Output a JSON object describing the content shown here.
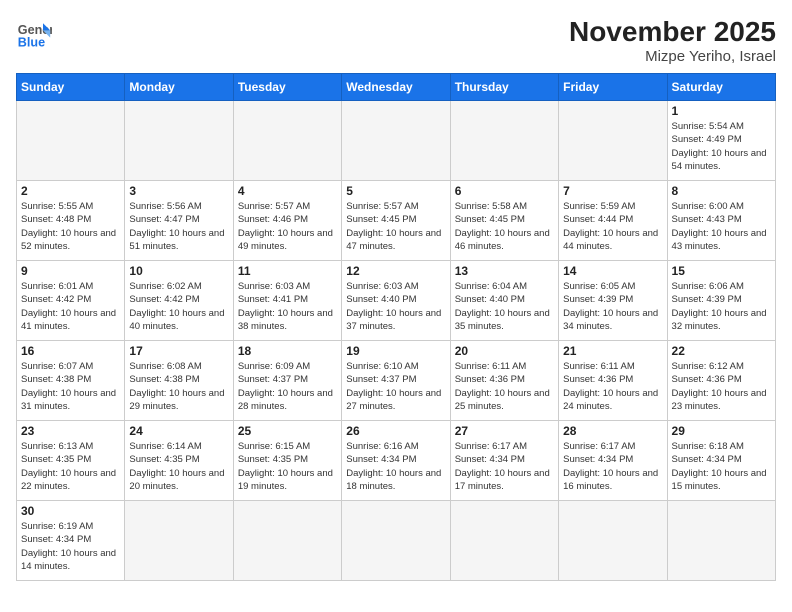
{
  "logo": {
    "line1": "General",
    "line2": "Blue"
  },
  "header": {
    "month": "November 2025",
    "location": "Mizpe Yeriho, Israel"
  },
  "days_of_week": [
    "Sunday",
    "Monday",
    "Tuesday",
    "Wednesday",
    "Thursday",
    "Friday",
    "Saturday"
  ],
  "weeks": [
    [
      {
        "day": "",
        "info": ""
      },
      {
        "day": "",
        "info": ""
      },
      {
        "day": "",
        "info": ""
      },
      {
        "day": "",
        "info": ""
      },
      {
        "day": "",
        "info": ""
      },
      {
        "day": "",
        "info": ""
      },
      {
        "day": "1",
        "info": "Sunrise: 5:54 AM\nSunset: 4:49 PM\nDaylight: 10 hours\nand 54 minutes."
      }
    ],
    [
      {
        "day": "2",
        "info": "Sunrise: 5:55 AM\nSunset: 4:48 PM\nDaylight: 10 hours\nand 52 minutes."
      },
      {
        "day": "3",
        "info": "Sunrise: 5:56 AM\nSunset: 4:47 PM\nDaylight: 10 hours\nand 51 minutes."
      },
      {
        "day": "4",
        "info": "Sunrise: 5:57 AM\nSunset: 4:46 PM\nDaylight: 10 hours\nand 49 minutes."
      },
      {
        "day": "5",
        "info": "Sunrise: 5:57 AM\nSunset: 4:45 PM\nDaylight: 10 hours\nand 47 minutes."
      },
      {
        "day": "6",
        "info": "Sunrise: 5:58 AM\nSunset: 4:45 PM\nDaylight: 10 hours\nand 46 minutes."
      },
      {
        "day": "7",
        "info": "Sunrise: 5:59 AM\nSunset: 4:44 PM\nDaylight: 10 hours\nand 44 minutes."
      },
      {
        "day": "8",
        "info": "Sunrise: 6:00 AM\nSunset: 4:43 PM\nDaylight: 10 hours\nand 43 minutes."
      }
    ],
    [
      {
        "day": "9",
        "info": "Sunrise: 6:01 AM\nSunset: 4:42 PM\nDaylight: 10 hours\nand 41 minutes."
      },
      {
        "day": "10",
        "info": "Sunrise: 6:02 AM\nSunset: 4:42 PM\nDaylight: 10 hours\nand 40 minutes."
      },
      {
        "day": "11",
        "info": "Sunrise: 6:03 AM\nSunset: 4:41 PM\nDaylight: 10 hours\nand 38 minutes."
      },
      {
        "day": "12",
        "info": "Sunrise: 6:03 AM\nSunset: 4:40 PM\nDaylight: 10 hours\nand 37 minutes."
      },
      {
        "day": "13",
        "info": "Sunrise: 6:04 AM\nSunset: 4:40 PM\nDaylight: 10 hours\nand 35 minutes."
      },
      {
        "day": "14",
        "info": "Sunrise: 6:05 AM\nSunset: 4:39 PM\nDaylight: 10 hours\nand 34 minutes."
      },
      {
        "day": "15",
        "info": "Sunrise: 6:06 AM\nSunset: 4:39 PM\nDaylight: 10 hours\nand 32 minutes."
      }
    ],
    [
      {
        "day": "16",
        "info": "Sunrise: 6:07 AM\nSunset: 4:38 PM\nDaylight: 10 hours\nand 31 minutes."
      },
      {
        "day": "17",
        "info": "Sunrise: 6:08 AM\nSunset: 4:38 PM\nDaylight: 10 hours\nand 29 minutes."
      },
      {
        "day": "18",
        "info": "Sunrise: 6:09 AM\nSunset: 4:37 PM\nDaylight: 10 hours\nand 28 minutes."
      },
      {
        "day": "19",
        "info": "Sunrise: 6:10 AM\nSunset: 4:37 PM\nDaylight: 10 hours\nand 27 minutes."
      },
      {
        "day": "20",
        "info": "Sunrise: 6:11 AM\nSunset: 4:36 PM\nDaylight: 10 hours\nand 25 minutes."
      },
      {
        "day": "21",
        "info": "Sunrise: 6:11 AM\nSunset: 4:36 PM\nDaylight: 10 hours\nand 24 minutes."
      },
      {
        "day": "22",
        "info": "Sunrise: 6:12 AM\nSunset: 4:36 PM\nDaylight: 10 hours\nand 23 minutes."
      }
    ],
    [
      {
        "day": "23",
        "info": "Sunrise: 6:13 AM\nSunset: 4:35 PM\nDaylight: 10 hours\nand 22 minutes."
      },
      {
        "day": "24",
        "info": "Sunrise: 6:14 AM\nSunset: 4:35 PM\nDaylight: 10 hours\nand 20 minutes."
      },
      {
        "day": "25",
        "info": "Sunrise: 6:15 AM\nSunset: 4:35 PM\nDaylight: 10 hours\nand 19 minutes."
      },
      {
        "day": "26",
        "info": "Sunrise: 6:16 AM\nSunset: 4:34 PM\nDaylight: 10 hours\nand 18 minutes."
      },
      {
        "day": "27",
        "info": "Sunrise: 6:17 AM\nSunset: 4:34 PM\nDaylight: 10 hours\nand 17 minutes."
      },
      {
        "day": "28",
        "info": "Sunrise: 6:17 AM\nSunset: 4:34 PM\nDaylight: 10 hours\nand 16 minutes."
      },
      {
        "day": "29",
        "info": "Sunrise: 6:18 AM\nSunset: 4:34 PM\nDaylight: 10 hours\nand 15 minutes."
      }
    ],
    [
      {
        "day": "30",
        "info": "Sunrise: 6:19 AM\nSunset: 4:34 PM\nDaylight: 10 hours\nand 14 minutes."
      },
      {
        "day": "",
        "info": ""
      },
      {
        "day": "",
        "info": ""
      },
      {
        "day": "",
        "info": ""
      },
      {
        "day": "",
        "info": ""
      },
      {
        "day": "",
        "info": ""
      },
      {
        "day": "",
        "info": ""
      }
    ]
  ]
}
